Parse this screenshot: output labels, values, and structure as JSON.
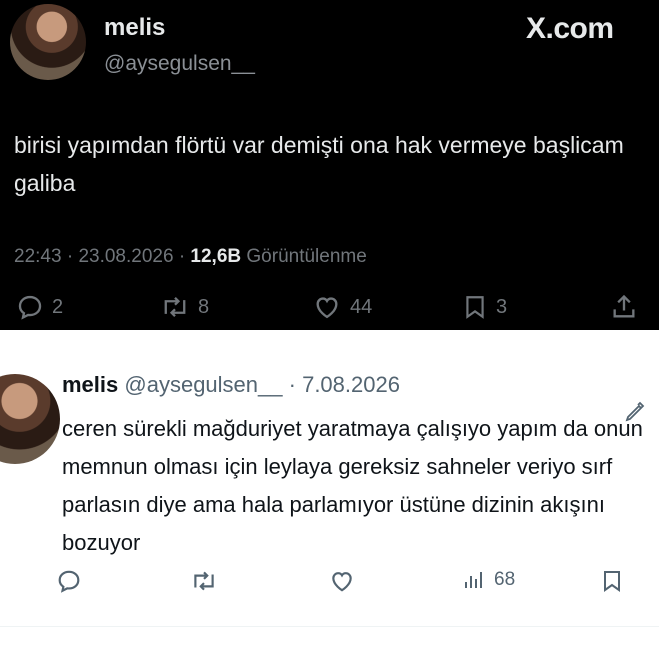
{
  "top_tweet": {
    "name": "melis",
    "handle": "@aysegulsen__",
    "brand": "X.com",
    "text": "birisi yapımdan flörtü var demişti ona hak vermeye başlicam galiba",
    "time": "22:43",
    "date": "23.08.2026",
    "views_count": "12,6B",
    "views_label": "Görüntülenme",
    "replies": "2",
    "reposts": "8",
    "likes": "44",
    "bookmarks": "3"
  },
  "bottom_tweet": {
    "name": "melis",
    "handle": "@aysegulsen__",
    "date": "7.08.2026",
    "text": "ceren sürekli mağduriyet yaratmaya çalışıyo yapım da onun memnun olması için leylaya gereksiz sahneler veriyo sırf parlasın diye ama hala parlamıyor üstüne dizinin akışını bozuyor",
    "views": "68"
  },
  "icons": [
    "reply-icon",
    "repost-icon",
    "like-icon",
    "bookmark-icon",
    "share-icon",
    "views-icon",
    "edited-icon"
  ],
  "colors": {
    "dark_bg": "#000000",
    "dark_text": "#e7e9ea",
    "dark_muted": "#71767b",
    "light_text": "#0f1419",
    "light_muted": "#536471"
  }
}
